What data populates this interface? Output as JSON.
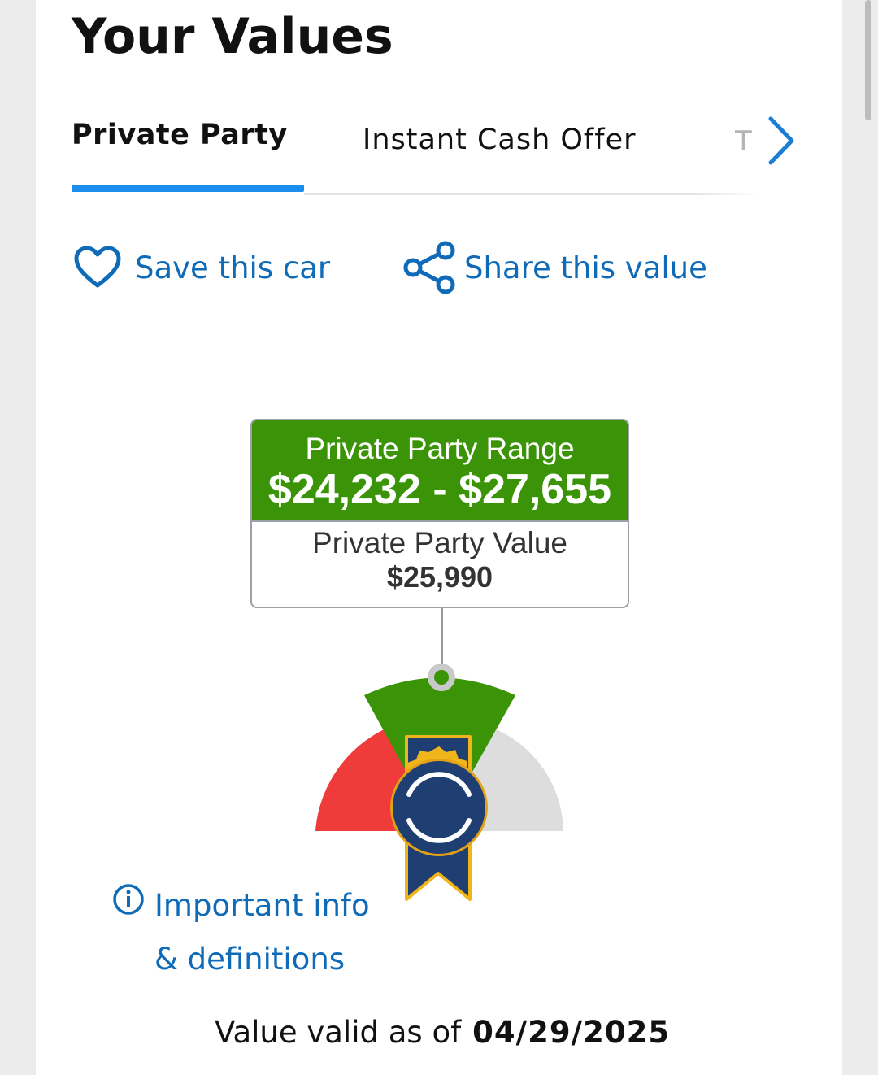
{
  "header": {
    "title": "Your Values"
  },
  "tabs": [
    {
      "label": "Private Party",
      "active": true
    },
    {
      "label": "Instant Cash Offer",
      "active": false
    },
    {
      "label": "T",
      "active": false
    }
  ],
  "actions": {
    "save_label": "Save this car",
    "share_label": "Share this value"
  },
  "valuation": {
    "range_label": "Private Party Range",
    "range_value": "$24,232 - $27,655",
    "value_label": "Private Party Value",
    "value_amount": "$25,990"
  },
  "gauge": {
    "segments": [
      "red",
      "green",
      "gray"
    ],
    "colors": {
      "low": "#f03b3b",
      "mid": "#3b9407",
      "high": "#dddddd"
    }
  },
  "info": {
    "line1": "Important info",
    "line2": "& definitions"
  },
  "footer": {
    "valid_prefix": "Value valid as of",
    "valid_date": "04/29/2025"
  },
  "icons": [
    "heart-icon",
    "share-icon",
    "chevron-right-icon",
    "info-icon",
    "ribbon-badge-icon"
  ],
  "colors": {
    "accent": "#1a8ded",
    "link": "#0f6bb8",
    "range_green": "#3b9407"
  }
}
